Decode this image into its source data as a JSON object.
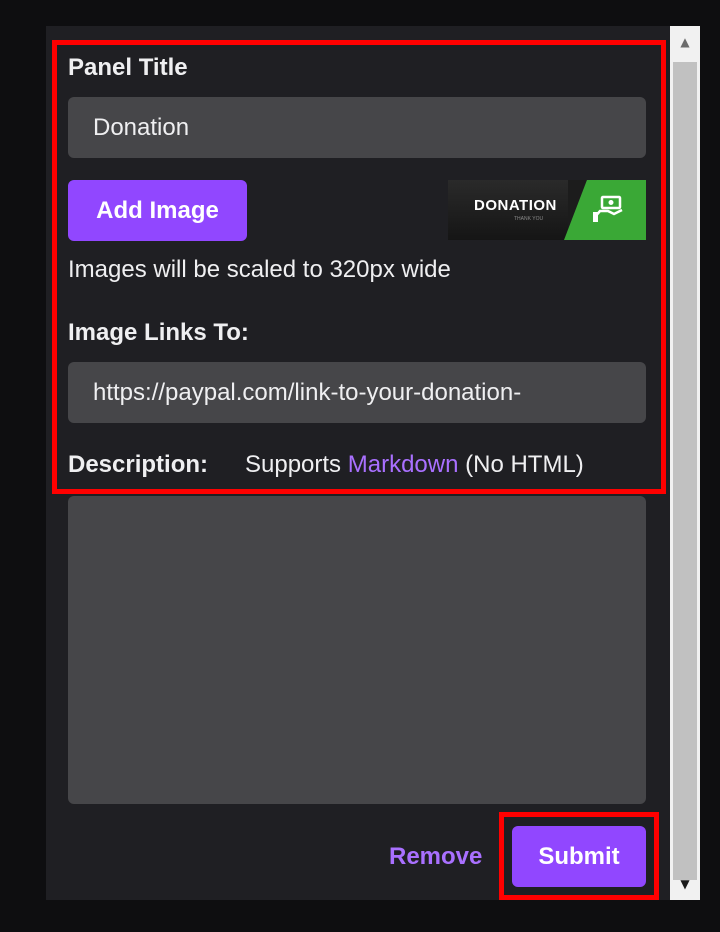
{
  "panel_title": {
    "label": "Panel Title",
    "value": "Donation"
  },
  "image": {
    "add_button": "Add Image",
    "preview_text": "DONATION",
    "preview_subtext": "THANK YOU",
    "scale_note": "Images will be scaled to 320px wide"
  },
  "image_link": {
    "label": "Image Links To:",
    "value": "https://paypal.com/link-to-your-donation-"
  },
  "description": {
    "label": "Description:",
    "supports_prefix": "Supports",
    "markdown_link": "Markdown",
    "no_html": "(No HTML)",
    "value": ""
  },
  "actions": {
    "remove": "Remove",
    "submit": "Submit"
  },
  "colors": {
    "accent": "#9147ff",
    "link": "#a970ff",
    "panel_bg": "#1f1f23",
    "field_bg": "#464649",
    "highlight": "#ff0000"
  }
}
